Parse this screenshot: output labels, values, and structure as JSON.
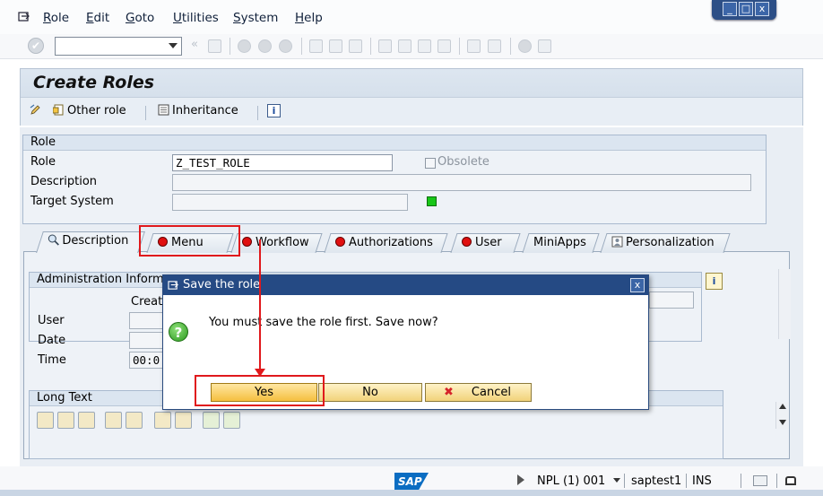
{
  "menu": {
    "items": [
      {
        "key": "R",
        "rest": "ole"
      },
      {
        "key": "E",
        "rest": "dit"
      },
      {
        "key": "G",
        "rest": "oto"
      },
      {
        "key": "U",
        "rest": "tilities"
      },
      {
        "key": "S",
        "rest": "ystem"
      },
      {
        "key": "H",
        "rest": "elp"
      }
    ]
  },
  "window_controls": {
    "minimize": "_",
    "maximize": "□",
    "close": "x"
  },
  "page": {
    "title": "Create Roles"
  },
  "app_toolbar": {
    "other_role": "Other role",
    "inheritance": "Inheritance",
    "info": "i"
  },
  "role_group": {
    "header": "Role",
    "role_label": "Role",
    "role_value": "Z_TEST_ROLE",
    "description_label": "Description",
    "target_system_label": "Target System",
    "obsolete_label": "Obsolete"
  },
  "tabs": [
    {
      "label": "Description"
    },
    {
      "label": "Menu"
    },
    {
      "label": "Workflow"
    },
    {
      "label": "Authorizations"
    },
    {
      "label": "User"
    },
    {
      "label": "MiniApps"
    },
    {
      "label": "Personalization"
    }
  ],
  "admin_group": {
    "header": "Administration Informa",
    "created_header": "Creat",
    "user_label": "User",
    "date_label": "Date",
    "time_label": "Time",
    "time_value": "00:0"
  },
  "long_text": {
    "header": "Long Text"
  },
  "dialog": {
    "title": "Save the role",
    "message": "You must save the role first. Save now?",
    "yes": "Yes",
    "no": "No",
    "cancel": "Cancel"
  },
  "status": {
    "system": "NPL (1) 001",
    "server": "saptest1",
    "mode": "INS",
    "logo": "SAP"
  },
  "colors": {
    "highlight": "#e0191c",
    "dialog_title": "#254a84",
    "status_green": "#18c618"
  }
}
